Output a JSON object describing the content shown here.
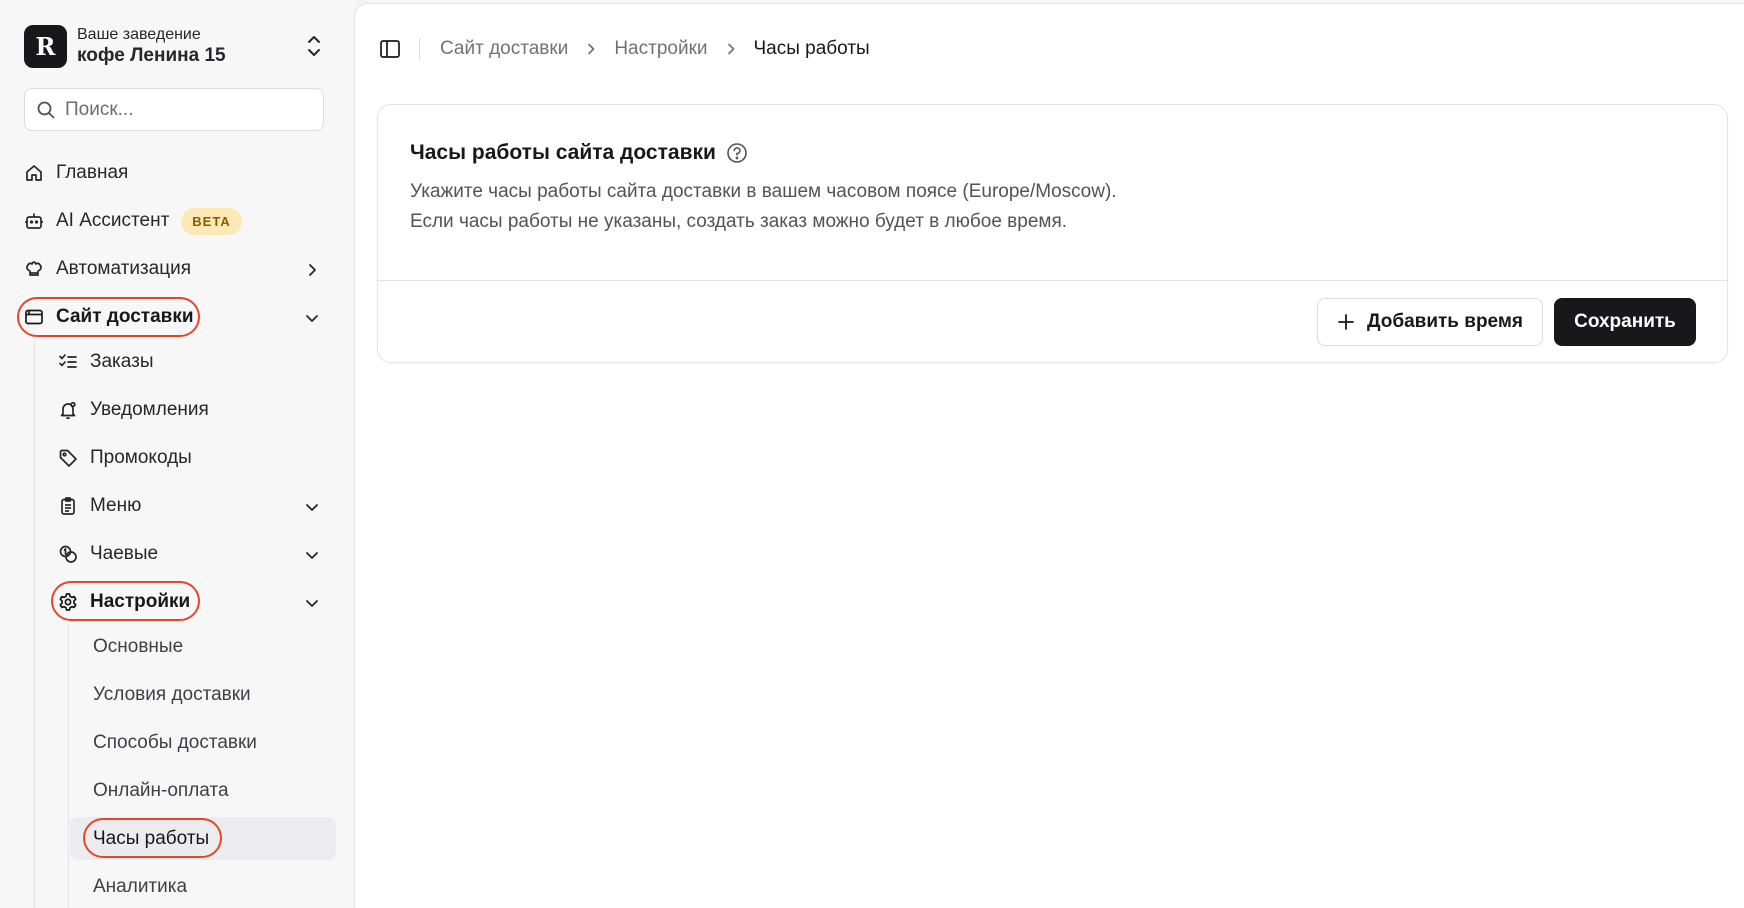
{
  "workspace": {
    "label": "Ваше заведение",
    "name": "кофе Ленина 15",
    "logo_letter": "R"
  },
  "search": {
    "placeholder": "Поиск..."
  },
  "nav": {
    "home": "Главная",
    "ai": {
      "label": "AI Ассистент",
      "badge": "BETA"
    },
    "automation": "Автоматизация",
    "delivery_site": "Сайт доставки",
    "delivery_children": {
      "orders": "Заказы",
      "notifications": "Уведомления",
      "promocodes": "Промокоды",
      "menu": "Меню",
      "tips": "Чаевые",
      "settings": "Настройки"
    },
    "settings_children": {
      "basic": "Основные",
      "delivery_conditions": "Условия доставки",
      "delivery_methods": "Способы доставки",
      "online_payment": "Онлайн-оплата",
      "working_hours": "Часы работы",
      "analytics": "Аналитика"
    }
  },
  "breadcrumb": {
    "item1": "Сайт доставки",
    "item2": "Настройки",
    "current": "Часы работы"
  },
  "card": {
    "title": "Часы работы сайта доставки",
    "desc_line1": "Укажите часы работы сайта доставки в вашем часовом поясе (Europe/Moscow).",
    "desc_line2": "Если часы работы не указаны, создать заказ можно будет в любое время.",
    "add_button": "Добавить время",
    "save_button": "Сохранить"
  },
  "colors": {
    "accent_dark": "#18181b",
    "highlight_ring": "#e5462b",
    "beta_bg": "#fde9b5",
    "beta_text": "#8a5a00"
  }
}
